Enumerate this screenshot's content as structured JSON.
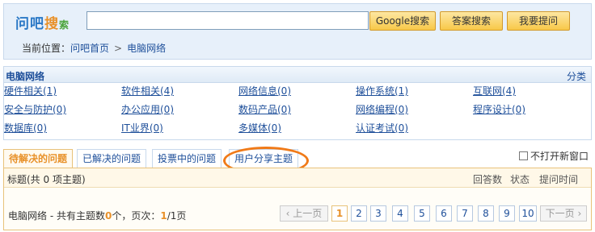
{
  "header": {
    "logo_main": "问吧",
    "logo_sou": "搜",
    "logo_suo": "索",
    "search_placeholder": "",
    "buttons": {
      "google": "Google搜索",
      "answer": "答案搜索",
      "ask": "我要提问"
    }
  },
  "breadcrumb": {
    "label": "当前位置：",
    "home": "问吧首页",
    "sep": ">",
    "current": "电脑网络"
  },
  "categories": {
    "title": "电脑网络",
    "more": "分类",
    "items": [
      "硬件相关(1)",
      "软件相关(4)",
      "网络信息(0)",
      "操作系统(1)",
      "互联网(4)",
      "安全与防护(0)",
      "办公应用(0)",
      "数码产品(0)",
      "网络编程(0)",
      "程序设计(0)",
      "数据库(0)",
      "IT业界(0)",
      "多媒体(0)",
      "认证考试(0)"
    ]
  },
  "tabs": [
    "待解决的问题",
    "已解决的问题",
    "投票中的问题",
    "用户分享主题"
  ],
  "no_new_window": "不打开新窗口",
  "list_header": {
    "title": "标题(共 0 项主题)",
    "answers": "回答数",
    "status": "状态",
    "time": "提问时间"
  },
  "summary": {
    "prefix": "电脑网络 - 共有主题数",
    "count": "0",
    "mid": "个，页次：",
    "page": "1",
    "total": "/1页"
  },
  "pager": {
    "prev": "上一页",
    "pages": [
      "1",
      "2",
      "3",
      "4",
      "5",
      "6",
      "7",
      "8",
      "9",
      "10"
    ],
    "next": "下一页"
  },
  "colors": {
    "accent": "#e8912a",
    "link": "#1e4f9a",
    "highlight_ring": "#f07a18"
  }
}
